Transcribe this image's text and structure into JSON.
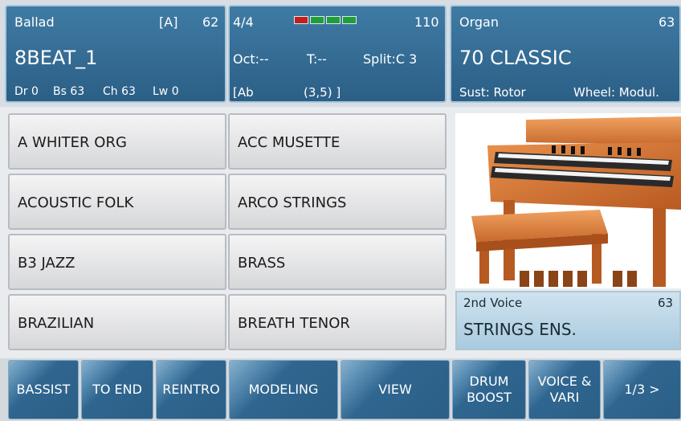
{
  "style_panel": {
    "style_category": "Ballad",
    "variation": "[A]",
    "volume": "62",
    "style_name": "8BEAT_1",
    "drum": "Dr 0",
    "bass": "Bs 63",
    "chord": "Ch 63",
    "lower": "Lw 0"
  },
  "tempo_panel": {
    "time_signature": "4/4",
    "tempo": "110",
    "octave": "Oct:--",
    "transpose": "T:--",
    "split": "Split:C 3",
    "chord_left": "[Ab",
    "chord_right": "(3,5) ]",
    "beat_colors": [
      "#c41d1d",
      "#1f9f3a",
      "#1f9f3a",
      "#1f9f3a"
    ]
  },
  "voice_panel": {
    "category": "Organ",
    "volume": "63",
    "voice_name": "70 CLASSIC",
    "sustain": "Sust: Rotor",
    "wheel": "Wheel: Modul."
  },
  "style_list": [
    "A WHITER ORG",
    "ACC MUSETTE",
    "ACOUSTIC FOLK",
    "ARCO STRINGS",
    "B3 JAZZ",
    "BRASS",
    "BRAZILIAN",
    "BREATH TENOR"
  ],
  "second_voice": {
    "label": "2nd Voice",
    "volume": "63",
    "name": "STRINGS ENS."
  },
  "bottom_buttons": [
    "BASSIST",
    "TO END",
    "REINTRO",
    "MODELING",
    "VIEW",
    "DRUM\nBOOST",
    "VOICE &\nVARI",
    "1/3 >"
  ],
  "colors": {
    "panel_blue": "#2b5f86",
    "panel_border": "#a9c8dc",
    "second_voice_bg": "#b9d6e8"
  }
}
